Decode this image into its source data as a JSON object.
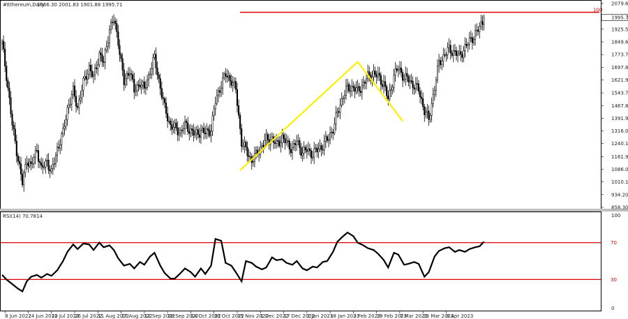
{
  "chart_data": [
    {
      "type": "candlestick",
      "header": {
        "symbol": "#Ethereum,Daily",
        "ohlc": "1966.30 2001.83 1901.88 1995.71"
      },
      "y_ticks": [
        "2079.60",
        "2001.83",
        "1925.55",
        "1849.60",
        "1773.70",
        "1697.80",
        "1621.90",
        "1543.70",
        "1467.80",
        "1391.90",
        "1316.00",
        "1240.10",
        "1161.90",
        "1086.00",
        "1010.10",
        "934.20",
        "858.30"
      ],
      "ylim": [
        858.3,
        2079.6
      ],
      "x_ticks": [
        "8 Jun 2022",
        "24 Jun 2022",
        "10 Jul 2022",
        "26 Jul 2022",
        "11 Aug 2022",
        "27 Aug 2022",
        "12 Sep 2022",
        "28 Sep 2022",
        "14 Oct 2022",
        "30 Oct 2022",
        "15 Nov 2022",
        "1 Dec 2022",
        "17 Dec 2022",
        "2 Jan 2023",
        "18 Jan 2023",
        "3 Feb 2023",
        "19 Feb 2023",
        "7 Mar 2023",
        "23 Mar 2023",
        "8 Apr 2023"
      ],
      "current_price_label": "1995.71",
      "resistance": {
        "value": 2001.83,
        "label": "100",
        "from": "17 Nov 2022"
      },
      "pattern_line": [
        {
          "date": "17 Nov 2022",
          "price": 1080
        },
        {
          "date": "6 Feb 2023",
          "price": 1730
        },
        {
          "date": "9 Mar 2023",
          "price": 1375
        }
      ],
      "price_path": [
        [
          0,
          1840
        ],
        [
          3,
          1650
        ],
        [
          7,
          1350
        ],
        [
          11,
          1150
        ],
        [
          14,
          1000
        ],
        [
          17,
          1150
        ],
        [
          20,
          1100
        ],
        [
          24,
          1210
        ],
        [
          27,
          1080
        ],
        [
          31,
          1140
        ],
        [
          34,
          1060
        ],
        [
          38,
          1210
        ],
        [
          42,
          1300
        ],
        [
          45,
          1450
        ],
        [
          49,
          1550
        ],
        [
          52,
          1460
        ],
        [
          56,
          1600
        ],
        [
          60,
          1700
        ],
        [
          63,
          1630
        ],
        [
          67,
          1780
        ],
        [
          70,
          1720
        ],
        [
          74,
          1930
        ],
        [
          77,
          1980
        ],
        [
          80,
          1860
        ],
        [
          84,
          1600
        ],
        [
          88,
          1690
        ],
        [
          91,
          1550
        ],
        [
          95,
          1610
        ],
        [
          98,
          1560
        ],
        [
          102,
          1680
        ],
        [
          105,
          1750
        ],
        [
          109,
          1580
        ],
        [
          112,
          1450
        ],
        [
          116,
          1350
        ],
        [
          119,
          1330
        ],
        [
          123,
          1310
        ],
        [
          126,
          1350
        ],
        [
          130,
          1320
        ],
        [
          133,
          1290
        ],
        [
          137,
          1320
        ],
        [
          140,
          1300
        ],
        [
          144,
          1330
        ],
        [
          147,
          1490
        ],
        [
          151,
          1600
        ],
        [
          154,
          1650
        ],
        [
          158,
          1620
        ],
        [
          161,
          1560
        ],
        [
          165,
          1250
        ],
        [
          168,
          1200
        ],
        [
          172,
          1140
        ],
        [
          175,
          1170
        ],
        [
          179,
          1230
        ],
        [
          182,
          1260
        ],
        [
          186,
          1270
        ],
        [
          189,
          1230
        ],
        [
          193,
          1280
        ],
        [
          196,
          1240
        ],
        [
          200,
          1210
        ],
        [
          203,
          1250
        ],
        [
          207,
          1190
        ],
        [
          210,
          1200
        ],
        [
          214,
          1180
        ],
        [
          217,
          1200
        ],
        [
          221,
          1230
        ],
        [
          224,
          1260
        ],
        [
          228,
          1330
        ],
        [
          231,
          1420
        ],
        [
          235,
          1530
        ],
        [
          238,
          1570
        ],
        [
          242,
          1580
        ],
        [
          245,
          1550
        ],
        [
          249,
          1600
        ],
        [
          252,
          1640
        ],
        [
          256,
          1660
        ],
        [
          259,
          1640
        ],
        [
          263,
          1600
        ],
        [
          266,
          1500
        ],
        [
          270,
          1650
        ],
        [
          273,
          1690
        ],
        [
          277,
          1640
        ],
        [
          280,
          1620
        ],
        [
          284,
          1590
        ],
        [
          287,
          1560
        ],
        [
          291,
          1440
        ],
        [
          294,
          1380
        ],
        [
          298,
          1580
        ],
        [
          301,
          1720
        ],
        [
          305,
          1780
        ],
        [
          308,
          1800
        ],
        [
          312,
          1790
        ],
        [
          315,
          1760
        ],
        [
          319,
          1820
        ],
        [
          322,
          1850
        ],
        [
          326,
          1900
        ],
        [
          329,
          1930
        ],
        [
          332,
          1995
        ]
      ],
      "rsi": {
        "label": "RSI(14) 70.7814",
        "levels": [
          70,
          30
        ],
        "level_labels": [
          "70",
          "30"
        ],
        "scale_labels": [
          "100",
          "0"
        ],
        "values": [
          [
            0,
            35
          ],
          [
            3,
            30
          ],
          [
            7,
            25
          ],
          [
            11,
            20
          ],
          [
            14,
            17
          ],
          [
            17,
            28
          ],
          [
            20,
            33
          ],
          [
            24,
            35
          ],
          [
            27,
            32
          ],
          [
            31,
            36
          ],
          [
            34,
            34
          ],
          [
            38,
            40
          ],
          [
            42,
            50
          ],
          [
            45,
            60
          ],
          [
            49,
            68
          ],
          [
            52,
            63
          ],
          [
            56,
            69
          ],
          [
            60,
            68
          ],
          [
            63,
            62
          ],
          [
            67,
            70
          ],
          [
            70,
            65
          ],
          [
            74,
            67
          ],
          [
            77,
            62
          ],
          [
            80,
            53
          ],
          [
            84,
            45
          ],
          [
            88,
            47
          ],
          [
            91,
            42
          ],
          [
            95,
            49
          ],
          [
            98,
            46
          ],
          [
            102,
            55
          ],
          [
            105,
            59
          ],
          [
            109,
            45
          ],
          [
            112,
            37
          ],
          [
            116,
            31
          ],
          [
            119,
            31
          ],
          [
            123,
            37
          ],
          [
            126,
            42
          ],
          [
            130,
            38
          ],
          [
            133,
            33
          ],
          [
            137,
            42
          ],
          [
            140,
            36
          ],
          [
            144,
            45
          ],
          [
            147,
            74
          ],
          [
            151,
            72
          ],
          [
            154,
            48
          ],
          [
            158,
            45
          ],
          [
            161,
            38
          ],
          [
            165,
            28
          ],
          [
            168,
            50
          ],
          [
            172,
            48
          ],
          [
            175,
            44
          ],
          [
            179,
            41
          ],
          [
            182,
            43
          ],
          [
            186,
            54
          ],
          [
            189,
            51
          ],
          [
            193,
            52
          ],
          [
            196,
            48
          ],
          [
            200,
            46
          ],
          [
            203,
            50
          ],
          [
            207,
            42
          ],
          [
            210,
            40
          ],
          [
            214,
            44
          ],
          [
            217,
            43
          ],
          [
            221,
            49
          ],
          [
            224,
            50
          ],
          [
            228,
            60
          ],
          [
            231,
            71
          ],
          [
            235,
            77
          ],
          [
            238,
            81
          ],
          [
            242,
            77
          ],
          [
            245,
            70
          ],
          [
            249,
            67
          ],
          [
            252,
            64
          ],
          [
            256,
            62
          ],
          [
            259,
            58
          ],
          [
            263,
            51
          ],
          [
            266,
            43
          ],
          [
            270,
            59
          ],
          [
            273,
            57
          ],
          [
            277,
            46
          ],
          [
            280,
            47
          ],
          [
            284,
            49
          ],
          [
            287,
            47
          ],
          [
            291,
            33
          ],
          [
            294,
            38
          ],
          [
            298,
            55
          ],
          [
            301,
            61
          ],
          [
            305,
            64
          ],
          [
            308,
            65
          ],
          [
            312,
            60
          ],
          [
            315,
            62
          ],
          [
            319,
            60
          ],
          [
            322,
            63
          ],
          [
            326,
            65
          ],
          [
            329,
            66
          ],
          [
            332,
            71
          ]
        ]
      }
    }
  ]
}
